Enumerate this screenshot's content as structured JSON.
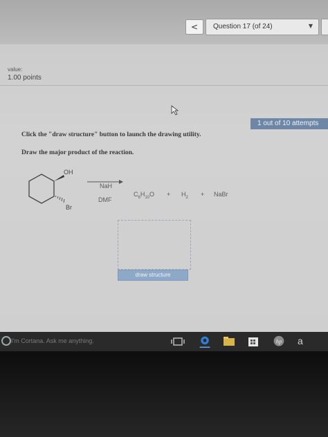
{
  "header": {
    "prev_label": "<",
    "question_selector": "Question 17 (of 24)",
    "caret": "▼"
  },
  "score": {
    "value_label": "value:",
    "points": "1.00 points"
  },
  "attempts_badge": "1 out of 10 attempts",
  "instructions": {
    "line1": "Click the \"draw structure\" button to launch the drawing utility.",
    "line2": "Draw the major product of the reaction."
  },
  "reaction": {
    "substituent_oh": "OH",
    "substituent_br": "Br",
    "reagent_top": "NaH",
    "reagent_bottom": "DMF",
    "product_formula": "C6H10O",
    "plus1": "+",
    "byproduct1": "H2",
    "plus2": "+",
    "byproduct2": "NaBr"
  },
  "draw_button_label": "draw structure",
  "taskbar": {
    "cortana_prompt": "I'm Cortana. Ask me anything.",
    "icons": [
      "task-view-icon",
      "edge-browser-icon",
      "file-explorer-icon",
      "store-icon",
      "hp-icon"
    ]
  },
  "keyboard_key": "a"
}
